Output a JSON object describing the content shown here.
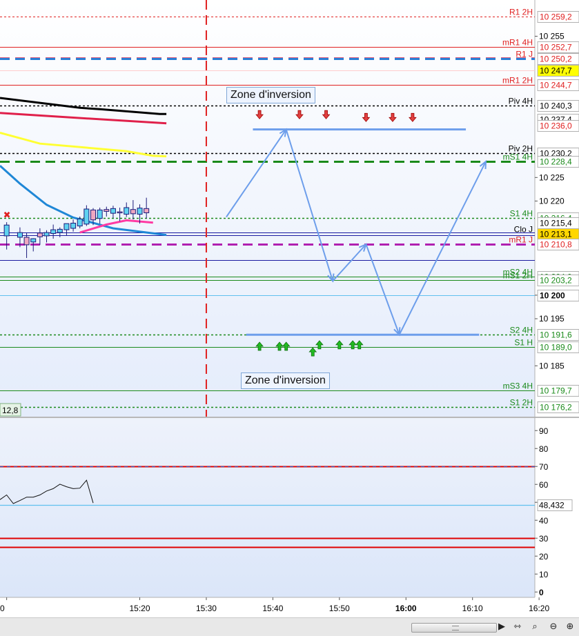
{
  "chart_data": [
    {
      "type": "candlestick",
      "title": "",
      "ylim": [
        10174.2,
        10262.7
      ],
      "xlim": [
        "14:59",
        "16:26"
      ],
      "yticks": [
        "10 255",
        "10 225",
        "10 220",
        "10 200",
        "10 195",
        "10 185"
      ],
      "xticks": [
        "0",
        "15:20",
        "15:30",
        "15:40",
        "15:50",
        "16:00",
        "16:10",
        "16:20"
      ],
      "session_separator": "15:30",
      "candles": [
        {
          "t": "15:00",
          "o": 10212.6,
          "h": 10215.5,
          "l": 10209.7,
          "c": 10214.9
        },
        {
          "t": "15:02",
          "o": 10212.3,
          "h": 10214.4,
          "l": 10210.2,
          "c": 10213.3
        },
        {
          "t": "15:03",
          "o": 10212.3,
          "h": 10213.2,
          "l": 10207.9,
          "c": 10210.7
        },
        {
          "t": "15:04",
          "o": 10211.3,
          "h": 10212.1,
          "l": 10209.3,
          "c": 10212.0
        },
        {
          "t": "15:05",
          "o": 10213.2,
          "h": 10214.2,
          "l": 10210.7,
          "c": 10212.4
        },
        {
          "t": "15:06",
          "o": 10212.6,
          "h": 10213.8,
          "l": 10211.2,
          "c": 10213.3
        },
        {
          "t": "15:07",
          "o": 10213.1,
          "h": 10215.0,
          "l": 10212.0,
          "c": 10213.9
        },
        {
          "t": "15:08",
          "o": 10213.3,
          "h": 10214.4,
          "l": 10212.3,
          "c": 10214.0
        },
        {
          "t": "15:09",
          "o": 10213.9,
          "h": 10215.2,
          "l": 10212.7,
          "c": 10215.2
        },
        {
          "t": "15:10",
          "o": 10214.2,
          "h": 10216.1,
          "l": 10213.5,
          "c": 10215.3
        },
        {
          "t": "15:11",
          "o": 10214.7,
          "h": 10216.7,
          "l": 10214.2,
          "c": 10216.2
        },
        {
          "t": "15:12",
          "o": 10215.1,
          "h": 10219.1,
          "l": 10214.7,
          "c": 10218.3
        },
        {
          "t": "15:13",
          "o": 10218.1,
          "h": 10218.5,
          "l": 10214.9,
          "c": 10216.0
        },
        {
          "t": "15:14",
          "o": 10216.3,
          "h": 10218.6,
          "l": 10215.2,
          "c": 10218.1
        },
        {
          "t": "15:15",
          "o": 10218.2,
          "h": 10218.8,
          "l": 10216.7,
          "c": 10217.8
        },
        {
          "t": "15:16",
          "o": 10217.4,
          "h": 10219.0,
          "l": 10216.4,
          "c": 10218.4
        },
        {
          "t": "15:17",
          "o": 10217.7,
          "h": 10218.6,
          "l": 10215.7,
          "c": 10217.5
        },
        {
          "t": "15:18",
          "o": 10217.2,
          "h": 10219.7,
          "l": 10216.6,
          "c": 10218.6
        },
        {
          "t": "15:19",
          "o": 10218.2,
          "h": 10220.2,
          "l": 10216.1,
          "c": 10217.3
        },
        {
          "t": "15:20",
          "o": 10217.2,
          "h": 10219.3,
          "l": 10215.2,
          "c": 10218.5
        },
        {
          "t": "15:21",
          "o": 10218.4,
          "h": 10220.7,
          "l": 10216.3,
          "c": 10217.5
        }
      ],
      "moving_averages": [
        {
          "color": "#000000",
          "points": [
            [
              "14:59",
              10241.9
            ],
            [
              "15:11",
              10239.8
            ],
            [
              "15:14",
              10239.5
            ],
            [
              "15:23",
              10238.5
            ],
            [
              "15:24",
              10238.5
            ]
          ]
        },
        {
          "color": "#e0204a",
          "points": [
            [
              "14:59",
              10238.7
            ],
            [
              "15:08",
              10237.9
            ],
            [
              "15:24",
              10236.5
            ]
          ]
        },
        {
          "color": "#ffff33",
          "points": [
            [
              "14:59",
              10234.5
            ],
            [
              "15:05",
              10232.2
            ],
            [
              "15:18",
              10230.6
            ],
            [
              "15:22",
              10229.6
            ],
            [
              "15:24",
              10229.5
            ]
          ]
        },
        {
          "color": "#1f87d6",
          "points": [
            [
              "14:59",
              10227.5
            ],
            [
              "15:02",
              10223.7
            ],
            [
              "15:06",
              10219.2
            ],
            [
              "15:10",
              10216.5
            ],
            [
              "15:16",
              10214.2
            ],
            [
              "15:24",
              10212.8
            ]
          ]
        },
        {
          "color": "#ff3aa3",
          "points": [
            [
              "15:11",
              10213.3
            ],
            [
              "15:15",
              10215.0
            ],
            [
              "15:18",
              10215.9
            ],
            [
              "15:22",
              10215.4
            ]
          ]
        }
      ],
      "levels": [
        {
          "label": "R1 2H",
          "value": 10259.2,
          "color": "#e02020",
          "style": "dashed",
          "axis_label": "10 259,2",
          "axis_bg": "#ffffff",
          "axis_text": "#e02020",
          "label_color": "#e02020"
        },
        {
          "label": "mR1 4H",
          "value": 10252.7,
          "color": "#e02020",
          "style": "solid",
          "axis_label": "10 252,7",
          "axis_bg": "#ffffff",
          "axis_text": "#e02020",
          "label_color": "#e02020"
        },
        {
          "label": "R1 J",
          "value": 10250.2,
          "color": "#2a7ed6",
          "style": "thickdashed",
          "axis_label": "10 250,2",
          "axis_bg": "#ffffff",
          "axis_text": "#e02020",
          "label_color": "#e02020"
        },
        {
          "label": "",
          "value": 10247.7,
          "color": "#ffcccc",
          "style": "solid",
          "axis_label": "10 247,7",
          "axis_bg": "#ffff00",
          "axis_text": "#000000",
          "label_color": "#000000"
        },
        {
          "label": "mR1 2H",
          "value": 10244.7,
          "color": "#e02020",
          "style": "solid",
          "axis_label": "10 244,7",
          "axis_bg": "#ffffff",
          "axis_text": "#e02020",
          "label_color": "#e02020"
        },
        {
          "label": "Piv 4H",
          "value": 10240.3,
          "color": "#000000",
          "style": "dotted",
          "axis_label": "10 240,3",
          "axis_bg": "#ffffff",
          "axis_text": "#000000",
          "label_color": "#000000"
        },
        {
          "label": "",
          "value": 10237.4,
          "color": "#000000",
          "style": "none",
          "axis_label": "10 237,4",
          "axis_bg": "#ffffff",
          "axis_text": "#000000",
          "label_color": "#000000"
        },
        {
          "label": "",
          "value": 10236.0,
          "color": "#e02020",
          "style": "none",
          "axis_label": "10 236,0",
          "axis_bg": "#ffffff",
          "axis_text": "#e02020",
          "label_color": "#e02020"
        },
        {
          "label": "Piv 2H",
          "value": 10230.2,
          "color": "#000000",
          "style": "dotted",
          "axis_label": "10 230,2",
          "axis_bg": "#ffffff",
          "axis_text": "#000000",
          "label_color": "#000000"
        },
        {
          "label": "mS1 4H",
          "value": 10228.4,
          "color": "#1a8a1a",
          "style": "thickdashed",
          "axis_label": "10 228,4",
          "axis_bg": "#ffffff",
          "axis_text": "#1a8a1a",
          "label_color": "#1a8a1a"
        },
        {
          "label": "S1 4H",
          "value": 10216.4,
          "color": "#1a8a1a",
          "style": "dotted",
          "axis_label": "10 216,4",
          "axis_bg": "#ffffff",
          "axis_text": "#1a8a1a",
          "label_color": "#1a8a1a"
        },
        {
          "label": "",
          "value": 10215.4,
          "color": "#000000",
          "style": "none",
          "axis_label": "10 215,4",
          "axis_bg": "#ffffff",
          "axis_text": "#000000",
          "label_color": "#000000"
        },
        {
          "label": "Clo J",
          "value": 10213.1,
          "color": "#1a1aa0",
          "style": "double",
          "axis_label": "10 213,1",
          "axis_bg": "#ffd700",
          "axis_text": "#000000",
          "label_color": "#000000"
        },
        {
          "label": "mR1 J",
          "value": 10210.8,
          "color": "#b020b0",
          "style": "thickdashed",
          "axis_label": "10 210,8",
          "axis_bg": "#ffffff",
          "axis_text": "#e02020",
          "label_color": "#e02020"
        },
        {
          "label": "",
          "value": 10207.5,
          "color": "#1a1aa0",
          "style": "solid",
          "axis_label": "",
          "axis_bg": "#ffffff",
          "axis_text": "#000000",
          "label_color": "#000000"
        },
        {
          "label": "mS2 4H",
          "value": 10204.0,
          "color": "#1a8a1a",
          "style": "solid",
          "axis_label": "10 204,0",
          "axis_bg": "#ffffff",
          "axis_text": "#1a8a1a",
          "label_color": "#1a8a1a"
        },
        {
          "label": "mS1 2H",
          "value": 10203.2,
          "color": "#1a8a1a",
          "style": "solid",
          "axis_label": "10 203,2",
          "axis_bg": "#ffffff",
          "axis_text": "#1a8a1a",
          "label_color": "#1a8a1a"
        },
        {
          "label": "",
          "value": 10200.0,
          "color": "#5fc0ef",
          "style": "solid",
          "axis_label": "10 200",
          "axis_bg": "#ffffff",
          "axis_text": "#000000",
          "label_color": "#000000",
          "bold": true
        },
        {
          "label": "S2 4H",
          "value": 10191.6,
          "color": "#1a8a1a",
          "style": "dotted",
          "axis_label": "10 191,6",
          "axis_bg": "#ffffff",
          "axis_text": "#1a8a1a",
          "label_color": "#1a8a1a"
        },
        {
          "label": "S1 H",
          "value": 10189.0,
          "color": "#1a8a1a",
          "style": "solid",
          "axis_label": "10 189,0",
          "axis_bg": "#ffffff",
          "axis_text": "#1a8a1a",
          "label_color": "#1a8a1a"
        },
        {
          "label": "mS3 4H",
          "value": 10179.7,
          "color": "#1a8a1a",
          "style": "solid",
          "axis_label": "10 179,7",
          "axis_bg": "#ffffff",
          "axis_text": "#1a8a1a",
          "label_color": "#1a8a1a"
        },
        {
          "label": "S1 2H",
          "value": 10176.2,
          "color": "#1a8a1a",
          "style": "dotted",
          "axis_label": "10 176,2",
          "axis_bg": "#ffffff",
          "axis_text": "#1a8a1a",
          "label_color": "#1a8a1a"
        }
      ],
      "horizontal_segments": [
        {
          "value": 10235.2,
          "from": "15:37",
          "to": "16:09",
          "color": "#6d9eeb"
        },
        {
          "value": 10191.6,
          "from": "15:36",
          "to": "16:11",
          "color": "#6d9eeb"
        }
      ],
      "projection_path": {
        "color": "#6d9eeb",
        "points": [
          [
            "15:33",
            10216.6
          ],
          [
            "15:42",
            10235.2
          ],
          [
            "15:49",
            10203.0
          ],
          [
            "15:54",
            10210.8
          ],
          [
            "15:59",
            10191.6
          ],
          [
            "16:12",
            10228.4
          ]
        ]
      },
      "sell_arrows": {
        "color": "#e04040",
        "points": [
          [
            "15:38",
            10238.2
          ],
          [
            "15:44",
            10238.2
          ],
          [
            "15:48",
            10238.2
          ],
          [
            "15:54",
            10237.6
          ],
          [
            "15:58",
            10237.6
          ],
          [
            "16:01",
            10237.6
          ]
        ]
      },
      "buy_arrows": {
        "color": "#22bb22",
        "points": [
          [
            "15:38",
            10189.3
          ],
          [
            "15:41",
            10189.3
          ],
          [
            "15:42",
            10189.3
          ],
          [
            "15:46",
            10188.1
          ],
          [
            "15:47",
            10189.6
          ],
          [
            "15:50",
            10189.6
          ],
          [
            "15:52",
            10189.6
          ],
          [
            "15:53",
            10189.6
          ]
        ]
      },
      "annotations": [
        {
          "id": "zone_top",
          "text": "Zone d'inversion"
        },
        {
          "id": "zone_bottom",
          "text": "Zone d'inversion"
        }
      ],
      "corner_value": "12,8"
    },
    {
      "type": "line",
      "title": "",
      "ylim": [
        -3,
        97
      ],
      "yticks": [
        "90",
        "80",
        "70",
        "60",
        "50",
        "40",
        "30",
        "20",
        "10",
        "0"
      ],
      "series": [
        {
          "values": [
            [
              "14:59",
              51.5
            ],
            [
              "15:00",
              54.1
            ],
            [
              "15:01",
              49.3
            ],
            [
              "15:02",
              51.0
            ],
            [
              "15:03",
              52.9
            ],
            [
              "15:04",
              52.9
            ],
            [
              "15:05",
              54.1
            ],
            [
              "15:06",
              56.3
            ],
            [
              "15:07",
              57.6
            ],
            [
              "15:08",
              60.1
            ],
            [
              "15:09",
              58.7
            ],
            [
              "15:10",
              57.6
            ],
            [
              "15:11",
              57.9
            ],
            [
              "15:12",
              62.3
            ],
            [
              "15:13",
              49.6
            ]
          ]
        }
      ],
      "levels": [
        {
          "value": 70.0,
          "color": "#e00000",
          "overlay": "#2060d0"
        },
        {
          "value": 48.432,
          "color": "#5fc0ef",
          "axis_label": "48,432"
        },
        {
          "value": 30.0,
          "color": "#e00000"
        },
        {
          "value": 25.0,
          "color": "#e00000"
        }
      ]
    }
  ],
  "toolbar": {
    "icons": [
      "scroll-left-icon",
      "scroll-right-icon",
      "bar-spacing-icon",
      "zoom-fit-icon",
      "zoom-out-icon",
      "zoom-in-icon"
    ]
  }
}
